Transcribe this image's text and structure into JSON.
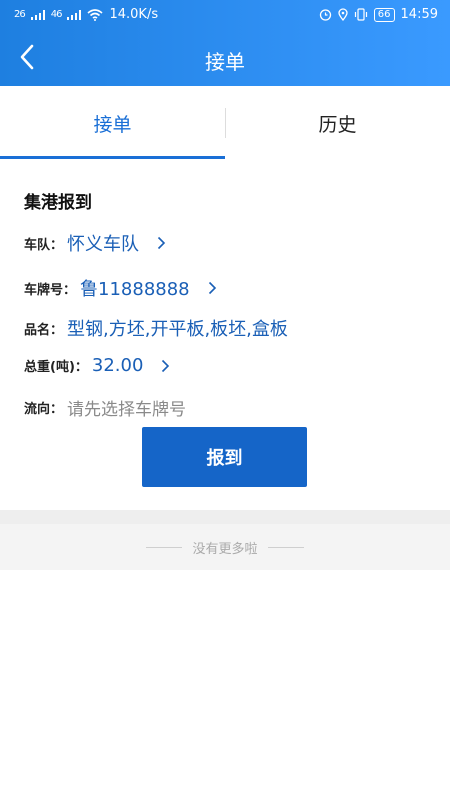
{
  "status_bar": {
    "network_speed": "14.0K/s",
    "time": "14:59",
    "battery": "66",
    "signal_1": "26",
    "signal_2": "46"
  },
  "header": {
    "title": "接单"
  },
  "tabs": [
    {
      "label": "接单",
      "active": true
    },
    {
      "label": "历史",
      "active": false
    }
  ],
  "card": {
    "title": "集港报到",
    "fields": {
      "fleet": {
        "label": "车队：",
        "value": "怀义车队"
      },
      "plate": {
        "label": "车牌号：",
        "value": "鲁11888888"
      },
      "goods": {
        "label": "品名：",
        "value": "型钢,方坯,开平板,板坯,盒板"
      },
      "weight": {
        "label": "总重(吨)：",
        "value": "32.00"
      },
      "flow": {
        "label": "流向：",
        "placeholder": "请先选择车牌号"
      }
    },
    "submit_label": "报到"
  },
  "footer": {
    "text": "没有更多啦"
  },
  "colors": {
    "accent": "#1e7fe0",
    "button": "#1565c8",
    "value_text": "#1a5fb6"
  }
}
